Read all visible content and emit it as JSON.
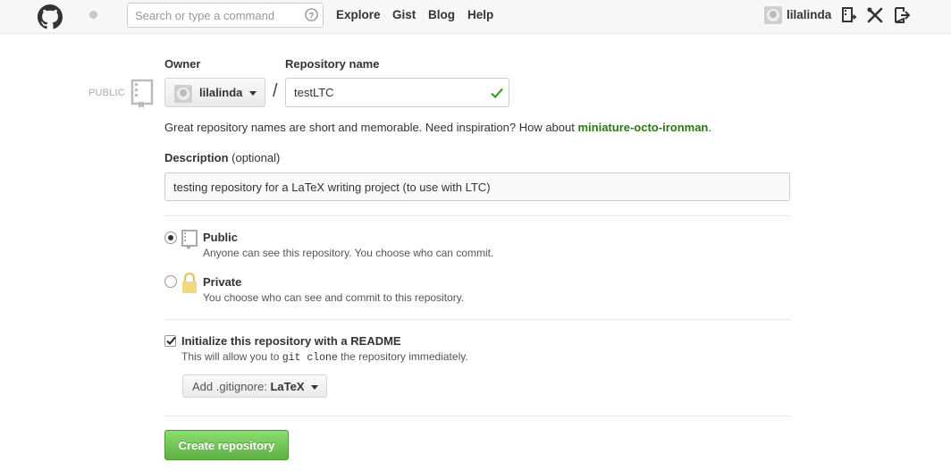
{
  "header": {
    "search_placeholder": "Search or type a command",
    "nav": {
      "explore": "Explore",
      "gist": "Gist",
      "blog": "Blog",
      "help": "Help"
    },
    "username": "lilalinda",
    "icons": [
      "github-logo-icon",
      "help-icon",
      "new-repo-icon",
      "settings-icon",
      "sign-out-icon"
    ]
  },
  "form": {
    "public_label": "PUBLIC",
    "owner_label": "Owner",
    "owner_value": "lilalinda",
    "repo_name_label": "Repository name",
    "slash": "/",
    "repo_name_value": "testLTC",
    "hint_text": "Great repository names are short and memorable. Need inspiration? How about ",
    "hint_suggestion": "miniature-octo-ironman",
    "hint_period": ".",
    "description_label": "Description",
    "description_optional": "(optional)",
    "description_value": "testing repository for a LaTeX writing project (to use with LTC)",
    "visibility": {
      "selected": "public",
      "public_title": "Public",
      "public_desc": "Anyone can see this repository. You choose who can commit.",
      "private_title": "Private",
      "private_desc": "You choose who can see and commit to this repository."
    },
    "readme": {
      "checked": true,
      "title": "Initialize this repository with a README",
      "desc_prefix": "This will allow you to ",
      "desc_code": "git clone",
      "desc_suffix": " the repository immediately."
    },
    "gitignore_prefix": "Add .gitignore: ",
    "gitignore_value": "LaTeX",
    "create_button": "Create repository"
  },
  "colors": {
    "suggestion_green": "#2c7a0f",
    "create_button_green": "#60b044",
    "check_green": "#3c9d24"
  }
}
